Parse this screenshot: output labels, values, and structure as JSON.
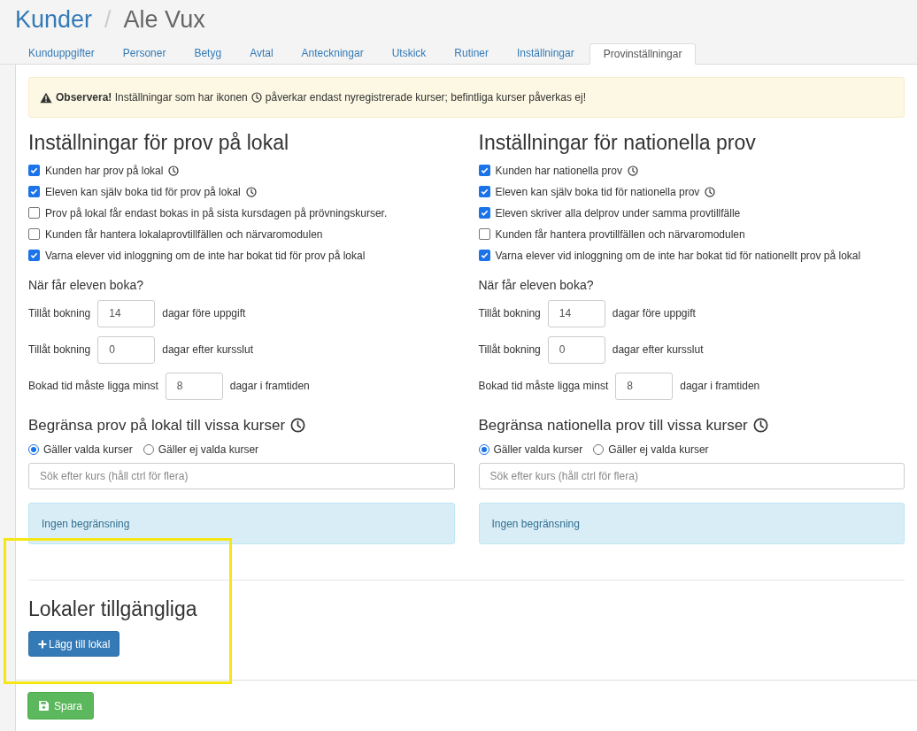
{
  "breadcrumb": {
    "parent": "Kunder",
    "separator": "/",
    "current": "Ale Vux"
  },
  "tabs": [
    {
      "label": "Kunduppgifter",
      "selected": false
    },
    {
      "label": "Personer",
      "selected": false
    },
    {
      "label": "Betyg",
      "selected": false
    },
    {
      "label": "Avtal",
      "selected": false
    },
    {
      "label": "Anteckningar",
      "selected": false
    },
    {
      "label": "Utskick",
      "selected": false
    },
    {
      "label": "Rutiner",
      "selected": false
    },
    {
      "label": "Inställningar",
      "selected": false
    },
    {
      "label": "Provinställningar",
      "selected": true
    }
  ],
  "alert": {
    "text": "**Observera!** Inställningar som har ikonen",
    "text_after": "påverkar endast nyregistrerade kurser; befintliga kurser påverkas ej!"
  },
  "sections": [
    {
      "title": "Inställningar för prov på lokal",
      "checkboxes": [
        {
          "label": "Kunden har prov på lokal",
          "checked": true,
          "clock": true
        },
        {
          "label": "Eleven kan själv boka tid för prov på lokal",
          "checked": true,
          "clock": true
        },
        {
          "label": "Prov på lokal får endast bokas in på sista kursdagen på prövningskurser.",
          "checked": false,
          "clock": false
        },
        {
          "label": "Kunden får hantera lokalaprovtillfällen och närvaromodulen",
          "checked": false,
          "clock": false
        },
        {
          "label": "Varna elever vid inloggning om de inte har bokat tid för prov på lokal",
          "checked": true,
          "clock": false
        }
      ],
      "booking_heading": "När får eleven boka?",
      "booking_rows": [
        {
          "label": "Tillåt bokning",
          "value": "14",
          "suffix": "dagar före uppgift"
        },
        {
          "label": "Tillåt bokning",
          "value": "0",
          "suffix": "dagar efter kursslut"
        },
        {
          "label": "Bokad tid måste ligga minst",
          "value": "8",
          "suffix": "dagar i framtiden"
        }
      ],
      "restrict_heading": "Begränsa prov på lokal till vissa kurser",
      "radios": [
        {
          "label": "Gäller valda kurser",
          "selected": true
        },
        {
          "label": "Gäller ej valda kurser",
          "selected": false
        }
      ],
      "search": {
        "placeholder": "Sök efter kurs (håll ctrl för flera)"
      },
      "info": "Ingen begränsning"
    },
    {
      "title": "Inställningar för nationella prov",
      "checkboxes": [
        {
          "label": "Kunden har nationella prov",
          "checked": true,
          "clock": true
        },
        {
          "label": "Eleven kan själv boka tid för nationella prov",
          "checked": true,
          "clock": true
        },
        {
          "label": "Eleven skriver alla delprov under samma provtillfälle",
          "checked": true,
          "clock": false
        },
        {
          "label": "Kunden får hantera provtillfällen och närvaromodulen",
          "checked": false,
          "clock": false
        },
        {
          "label": "Varna elever vid inloggning om de inte har bokat tid för nationellt prov på lokal",
          "checked": true,
          "clock": false
        }
      ],
      "booking_heading": "När får eleven boka?",
      "booking_rows": [
        {
          "label": "Tillåt bokning",
          "value": "14",
          "suffix": "dagar före uppgift"
        },
        {
          "label": "Tillåt bokning",
          "value": "0",
          "suffix": "dagar efter kursslut"
        },
        {
          "label": "Bokad tid måste ligga minst",
          "value": "8",
          "suffix": "dagar i framtiden"
        }
      ],
      "restrict_heading": "Begränsa nationella prov till vissa kurser",
      "radios": [
        {
          "label": "Gäller valda kurser",
          "selected": true
        },
        {
          "label": "Gäller ej valda kurser",
          "selected": false
        }
      ],
      "search": {
        "placeholder": "Sök efter kurs (håll ctrl för flera)"
      },
      "info": "Ingen begränsning"
    }
  ],
  "locations": {
    "title": "Lokaler tillgängliga",
    "button": "Lägg till lokal"
  },
  "save_button": "Spara",
  "highlight": true
}
